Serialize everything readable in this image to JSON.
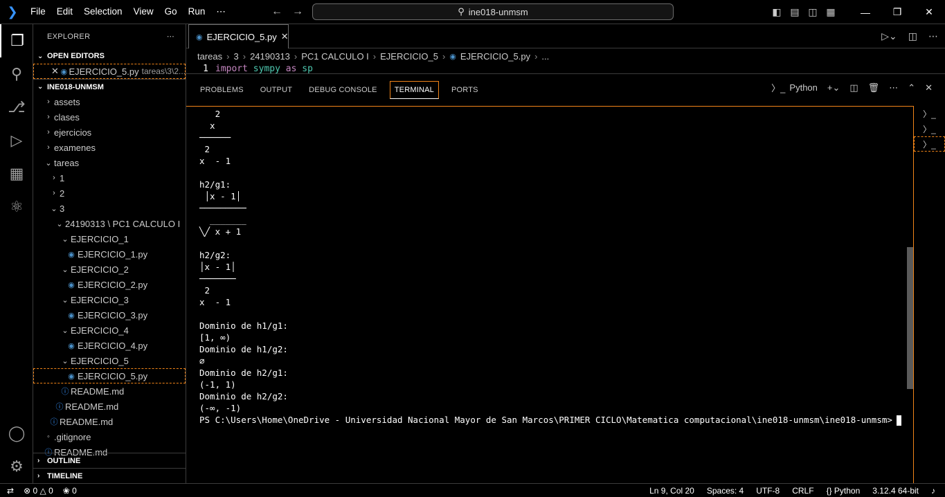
{
  "titlebar": {
    "menu": [
      "File",
      "Edit",
      "Selection",
      "View",
      "Go",
      "Run",
      "⋯"
    ],
    "search": "ine018-unmsm"
  },
  "sidebar": {
    "header": "EXPLORER",
    "open_editors_label": "OPEN EDITORS",
    "open_editor": {
      "name": "EJERCICIO_5.py",
      "path": "tareas\\3\\2..."
    },
    "workspace_label": "INE018-UNMSM",
    "tree": [
      {
        "label": "assets",
        "type": "folder",
        "indent": 0,
        "open": false
      },
      {
        "label": "clases",
        "type": "folder",
        "indent": 0,
        "open": false
      },
      {
        "label": "ejercicios",
        "type": "folder",
        "indent": 0,
        "open": false
      },
      {
        "label": "examenes",
        "type": "folder",
        "indent": 0,
        "open": false
      },
      {
        "label": "tareas",
        "type": "folder",
        "indent": 0,
        "open": true
      },
      {
        "label": "1",
        "type": "folder",
        "indent": 1,
        "open": false
      },
      {
        "label": "2",
        "type": "folder",
        "indent": 1,
        "open": false
      },
      {
        "label": "3",
        "type": "folder",
        "indent": 1,
        "open": true
      },
      {
        "label": "24190313 \\ PC1 CALCULO I",
        "type": "folder",
        "indent": 2,
        "open": true
      },
      {
        "label": "EJERCICIO_1",
        "type": "folder",
        "indent": 3,
        "open": true
      },
      {
        "label": "EJERCICIO_1.py",
        "type": "py",
        "indent": 4
      },
      {
        "label": "EJERCICIO_2",
        "type": "folder",
        "indent": 3,
        "open": true
      },
      {
        "label": "EJERCICIO_2.py",
        "type": "py",
        "indent": 4
      },
      {
        "label": "EJERCICIO_3",
        "type": "folder",
        "indent": 3,
        "open": true
      },
      {
        "label": "EJERCICIO_3.py",
        "type": "py",
        "indent": 4
      },
      {
        "label": "EJERCICIO_4",
        "type": "folder",
        "indent": 3,
        "open": true
      },
      {
        "label": "EJERCICIO_4.py",
        "type": "py",
        "indent": 4
      },
      {
        "label": "EJERCICIO_5",
        "type": "folder",
        "indent": 3,
        "open": true
      },
      {
        "label": "EJERCICIO_5.py",
        "type": "py",
        "indent": 4,
        "selected": true
      },
      {
        "label": "README.md",
        "type": "md",
        "indent": 3
      },
      {
        "label": "README.md",
        "type": "md",
        "indent": 2
      },
      {
        "label": "README.md",
        "type": "md",
        "indent": 1
      },
      {
        "label": ".gitignore",
        "type": "git",
        "indent": 0
      },
      {
        "label": "README.md",
        "type": "md",
        "indent": 0
      }
    ],
    "outline_label": "OUTLINE",
    "timeline_label": "TIMELINE"
  },
  "editor": {
    "tab_label": "EJERCICIO_5.py",
    "breadcrumbs": [
      "tareas",
      "3",
      "24190313",
      "PC1 CALCULO I",
      "EJERCICIO_5",
      "EJERCICIO_5.py",
      "..."
    ],
    "line_number": "1",
    "code": {
      "kw1": "import",
      "mod": "sympy",
      "kw2": "as",
      "alias": "sp"
    }
  },
  "panel": {
    "tabs": [
      "PROBLEMS",
      "OUTPUT",
      "DEBUG CONSOLE",
      "TERMINAL",
      "PORTS"
    ],
    "active_tab": "TERMINAL",
    "shell_label": "Python",
    "terminal_lines": [
      "   2",
      "  x",
      "──────",
      " 2",
      "x  - 1",
      "",
      "h2/g1:",
      " │x - 1│",
      "─────────",
      "  _______",
      "╲╱ x + 1",
      "",
      "h2/g2:",
      "│x - 1│",
      "───────",
      " 2",
      "x  - 1",
      "",
      "Dominio de h1/g1:",
      "[1, ∞)",
      "Dominio de h1/g2:",
      "∅",
      "Dominio de h2/g1:",
      "(-1, 1)",
      "Dominio de h2/g2:",
      "(-∞, -1)"
    ],
    "prompt": "PS C:\\Users\\Home\\OneDrive - Universidad Nacional Mayor de San Marcos\\PRIMER CICLO\\Matematica computacional\\ine018-unmsm\\ine018-unmsm>"
  },
  "status": {
    "errors": "0",
    "warnings": "0",
    "ports": "0",
    "position": "Ln 9, Col 20",
    "spaces": "Spaces: 4",
    "encoding": "UTF-8",
    "eol": "CRLF",
    "language": "Python",
    "interpreter": "3.12.4 64-bit"
  }
}
